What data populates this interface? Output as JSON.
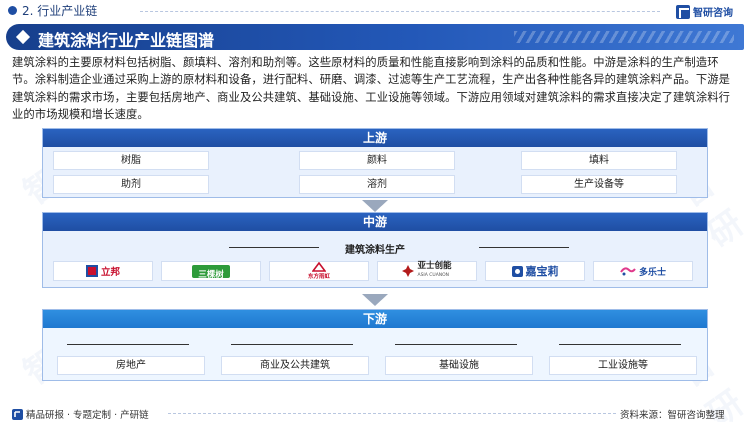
{
  "header": {
    "section": "2. 行业产业链",
    "brand": "智研咨询"
  },
  "title": "建筑涂料行业产业链图谱",
  "description": "建筑涂料的主要原材料包括树脂、颜填料、溶剂和助剂等。这些原材料的质量和性能直接影响到涂料的品质和性能。中游是涂料的生产制造环节。涂料制造企业通过采购上游的原材料和设备，进行配料、研磨、调漆、过滤等生产工艺流程，生产出各种性能各异的建筑涂料产品。下游是建筑涂料的需求市场，主要包括房地产、商业及公共建筑、基础设施、工业设施等领域。下游应用领域对建筑涂料的需求直接决定了建筑涂料行业的市场规模和增长速度。",
  "upstream": {
    "label": "上游",
    "items": [
      "树脂",
      "颜料",
      "填料",
      "助剂",
      "溶剂",
      "生产设备等"
    ]
  },
  "midstream": {
    "label": "中游",
    "sublabel": "建筑涂料生产",
    "brands": [
      {
        "name": "立邦",
        "color": "#c8102e",
        "icon": "nippon-logo"
      },
      {
        "name": "三棵树",
        "color": "#2e9b3a",
        "icon": "skshu-logo"
      },
      {
        "name": "东方雨虹",
        "color": "#c8102e",
        "icon": "oriental-yuhong-logo"
      },
      {
        "name": "亚士创能",
        "sub": "ASIA CUANON",
        "color": "#b31b1b",
        "icon": "asia-cuanon-logo"
      },
      {
        "name": "嘉宝莉",
        "color": "#1f4ea3",
        "icon": "carpoly-logo"
      },
      {
        "name": "多乐士",
        "color": "#e03a8c",
        "icon": "dulux-logo"
      }
    ]
  },
  "downstream": {
    "label": "下游",
    "items": [
      "房地产",
      "商业及公共建筑",
      "基础设施",
      "工业设施等"
    ]
  },
  "footer": {
    "left": "精品研报 · 专题定制 · 产研链",
    "right": "资料来源：智研咨询整理"
  },
  "colors": {
    "primary": "#1f4ea3",
    "downstream_header": "#1f78d0",
    "panel_bg": "#e9f1fd"
  }
}
